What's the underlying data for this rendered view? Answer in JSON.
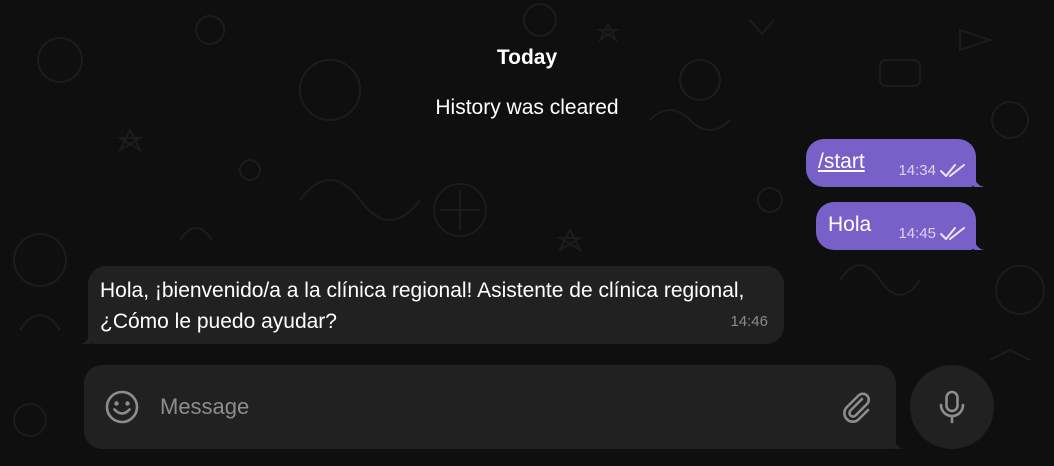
{
  "chat": {
    "date_label": "Today",
    "service_message": "History was cleared"
  },
  "messages": [
    {
      "direction": "outgoing",
      "text": "/start",
      "time": "14:34",
      "status": "read"
    },
    {
      "direction": "outgoing",
      "text": "Hola",
      "time": "14:45",
      "status": "read"
    },
    {
      "direction": "incoming",
      "text": "Hola, ¡bienvenido/a a la clínica regional! Asistente de clínica regional, ¿Cómo le puedo ayudar?",
      "time": "14:46"
    }
  ],
  "composer": {
    "placeholder": "Message",
    "emoji_icon": "smile-icon",
    "attach_icon": "paperclip-icon",
    "voice_icon": "microphone-icon"
  },
  "colors": {
    "background": "#0f0f0f",
    "outgoing_bubble": "#7860c9",
    "incoming_bubble": "#212121",
    "composer": "#212121",
    "secondary_text": "#8a8a8a"
  }
}
